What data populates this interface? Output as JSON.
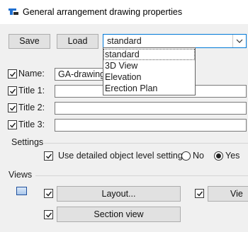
{
  "window": {
    "title": "General arrangement drawing properties"
  },
  "toolbar": {
    "save_label": "Save",
    "load_label": "Load",
    "settings_combo_value": "standard",
    "settings_options": [
      "standard",
      "3D View",
      "Elevation",
      "Erection Plan"
    ]
  },
  "fields": {
    "name_label": "Name:",
    "name_value": "GA-drawing",
    "title1_label": "Title 1:",
    "title2_label": "Title 2:",
    "title3_label": "Title 3:"
  },
  "settings": {
    "group_label": "Settings",
    "detailed_label": "Use detailed object level settings",
    "no_label": "No",
    "yes_label": "Yes",
    "selected": "Yes"
  },
  "views": {
    "group_label": "Views",
    "layout_button": "Layout...",
    "section_button": "Section view",
    "view_button_partial": "Vie"
  }
}
